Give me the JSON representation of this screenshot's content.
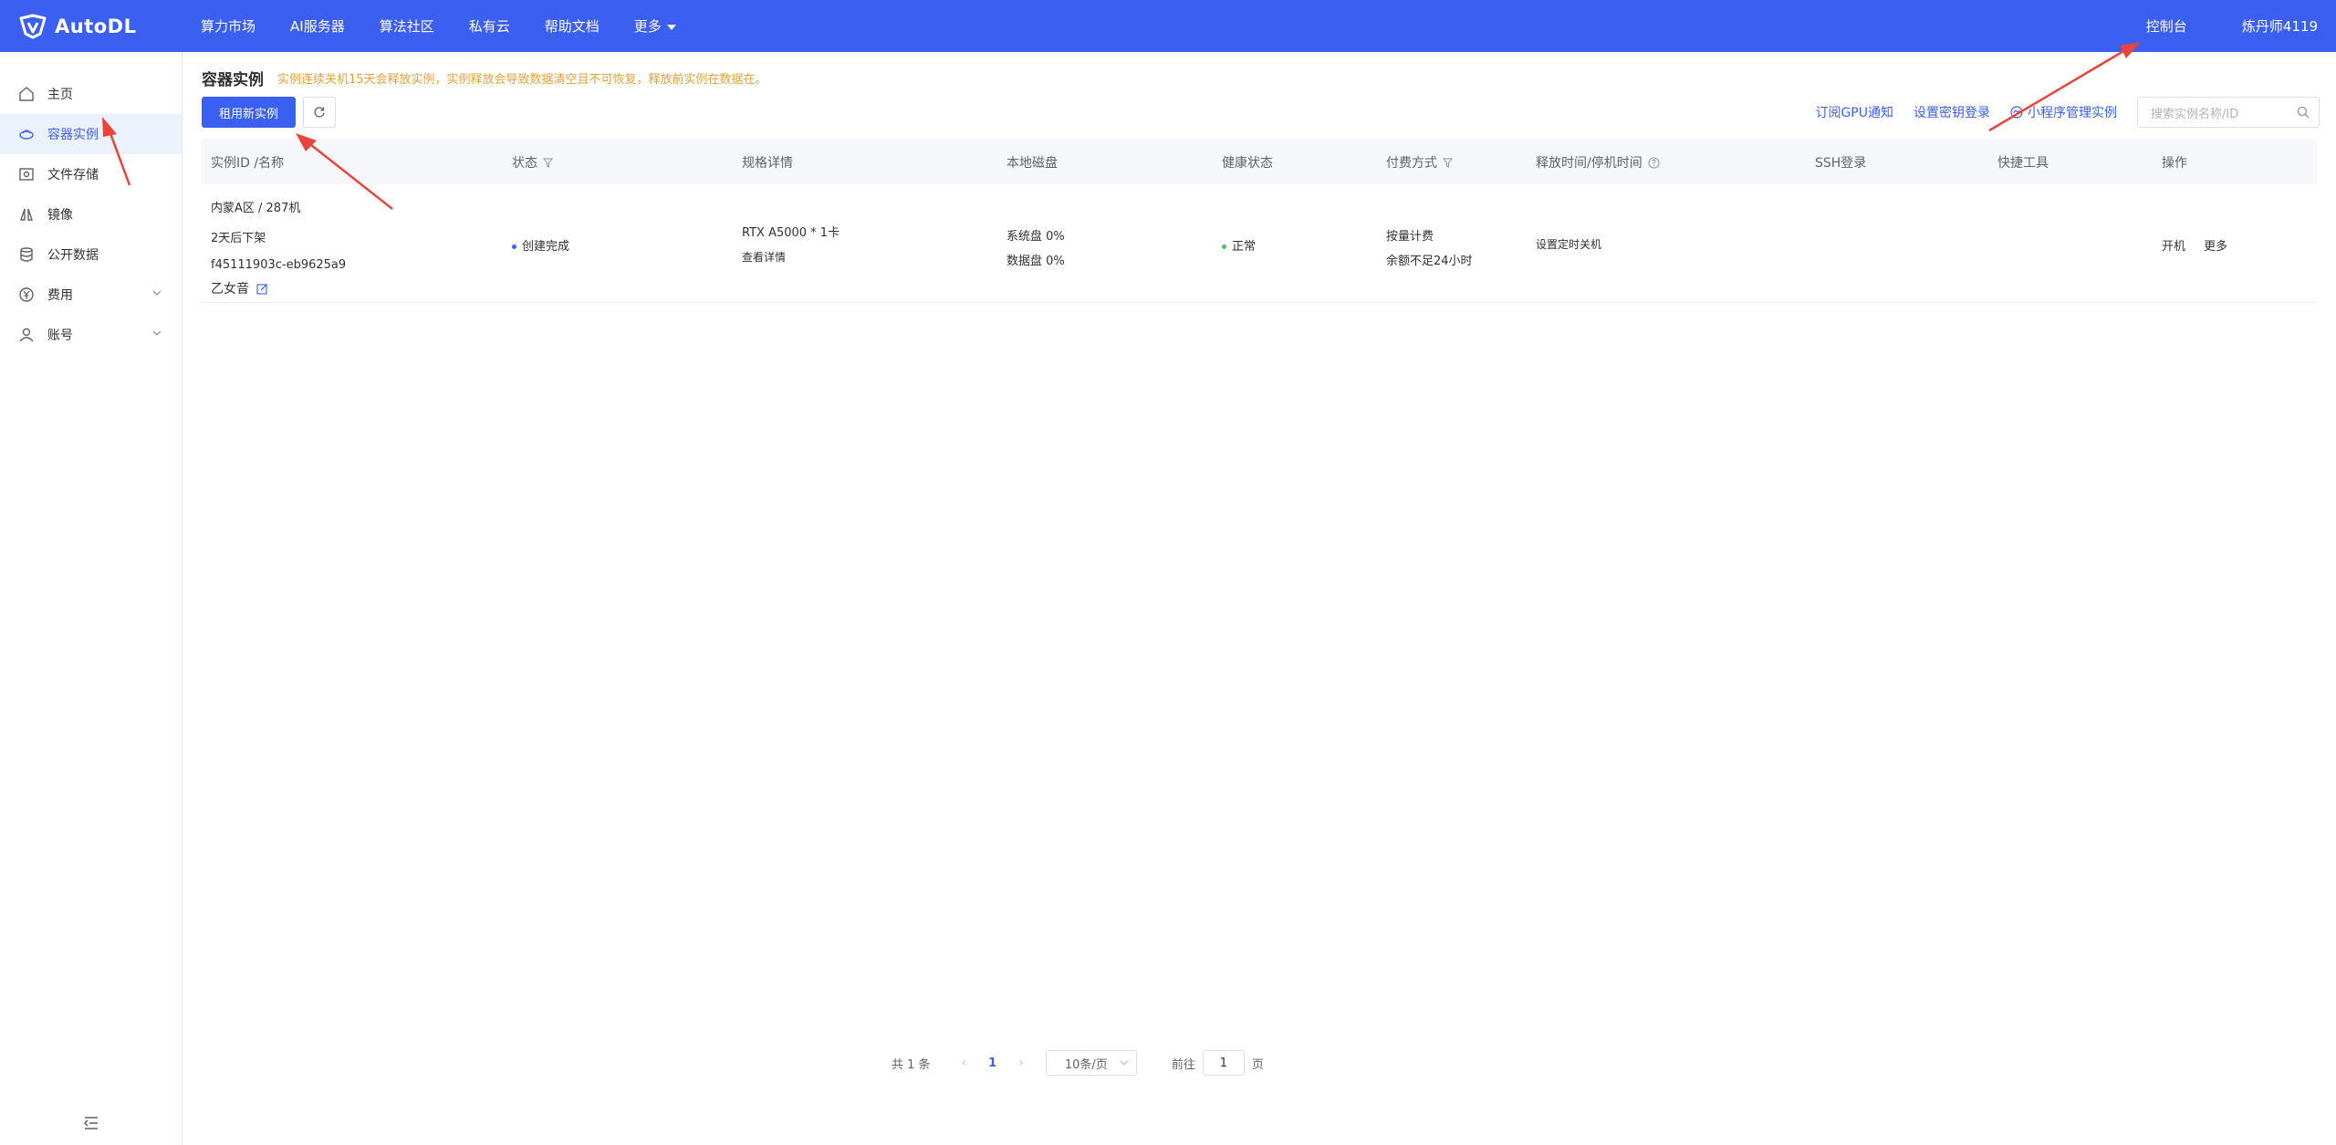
{
  "brand": {
    "name": "AutoDL"
  },
  "nav": {
    "items": [
      "算力市场",
      "AI服务器",
      "算法社区",
      "私有云",
      "帮助文档"
    ],
    "more": "更多"
  },
  "top_right": {
    "console": "控制台",
    "user": "炼丹师4119"
  },
  "sidebar": {
    "items": [
      {
        "label": "主页",
        "icon": "home-icon"
      },
      {
        "label": "容器实例",
        "icon": "container-icon",
        "active": true
      },
      {
        "label": "文件存储",
        "icon": "storage-icon"
      },
      {
        "label": "镜像",
        "icon": "image-icon"
      },
      {
        "label": "公开数据",
        "icon": "database-icon"
      },
      {
        "label": "费用",
        "icon": "yen-icon",
        "expandable": true
      },
      {
        "label": "账号",
        "icon": "user-icon",
        "expandable": true
      }
    ]
  },
  "page": {
    "title": "容器实例",
    "notice": "实例连续关机15天会释放实例，实例释放会导致数据清空且不可恢复，释放前实例在数据在。",
    "create_button": "租用新实例",
    "toolbar": {
      "gpu_notice": "订阅GPU通知",
      "ssh_key": "设置密钥登录",
      "mini_program": "小程序管理实例",
      "search_placeholder": "搜索实例名称/ID"
    }
  },
  "table": {
    "headers": {
      "id": "实例ID /名称",
      "status": "状态",
      "spec": "规格详情",
      "disk": "本地磁盘",
      "health": "健康状态",
      "billing": "付费方式",
      "release": "释放时间/停机时间",
      "ssh": "SSH登录",
      "tools": "快捷工具",
      "actions": "操作"
    },
    "rows": [
      {
        "region": "内蒙A区 / 287机",
        "expiry": "2天后下架",
        "instance_id": "f45111903c-eb9625a9",
        "name": "乙女音",
        "status": "创建完成",
        "spec": "RTX A5000 * 1卡",
        "spec_link": "查看详情",
        "system_disk": "系统盘 0%",
        "data_disk": "数据盘 0%",
        "health": "正常",
        "billing": "按量计费",
        "billing_warn": "余额不足24小时",
        "release": "设置定时关机",
        "action_start": "开机",
        "action_more": "更多"
      }
    ]
  },
  "pagination": {
    "total": "共 1 条",
    "current": "1",
    "page_size": "10条/页",
    "goto_label": "前往",
    "goto_value": "1",
    "page_suffix": "页"
  },
  "colors": {
    "primary": "#3b5ff0",
    "warning": "#e6a23c",
    "danger": "#e64b3c",
    "success": "#46c35f",
    "annotation": "#e8453c"
  }
}
